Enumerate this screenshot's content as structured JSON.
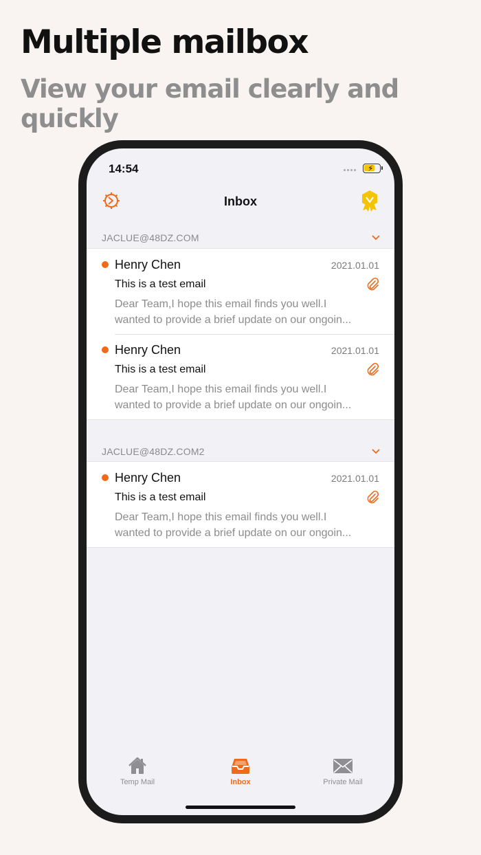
{
  "promo": {
    "headline": "Multiple mailbox",
    "subline": "View your email clearly and quickly"
  },
  "status_bar": {
    "time": "14:54"
  },
  "nav": {
    "title": "Inbox",
    "left_icon": "gear-icon",
    "right_icon": "vip-badge-icon"
  },
  "accounts": [
    {
      "address": "JACLUE@48DZ.COM",
      "emails": [
        {
          "sender": "Henry Chen",
          "date": "2021.01.01",
          "subject": "This is a test email",
          "preview_line1": "Dear Team,I hope this email finds you well.I",
          "preview_line2": "wanted to provide a brief update on our ongoin..."
        },
        {
          "sender": "Henry Chen",
          "date": "2021.01.01",
          "subject": "This is a test email",
          "preview_line1": "Dear Team,I hope this email finds you well.I",
          "preview_line2": "wanted to provide a brief update on our ongoin..."
        }
      ]
    },
    {
      "address": "JACLUE@48DZ.COM2",
      "emails": [
        {
          "sender": "Henry Chen",
          "date": "2021.01.01",
          "subject": "This is a test email",
          "preview_line1": "Dear Team,I hope this email finds you well.I",
          "preview_line2": "wanted to provide a brief update on our ongoin..."
        }
      ]
    }
  ],
  "tabs": [
    {
      "label": "Temp Mail",
      "icon": "home-icon"
    },
    {
      "label": "Inbox",
      "icon": "inbox-tray-icon",
      "active": true
    },
    {
      "label": "Private Mail",
      "icon": "envelope-icon"
    }
  ],
  "colors": {
    "accent": "#f06a1c",
    "badge": "#f5c400",
    "background": "#f9f4f1",
    "screen": "#f2f1f6"
  }
}
